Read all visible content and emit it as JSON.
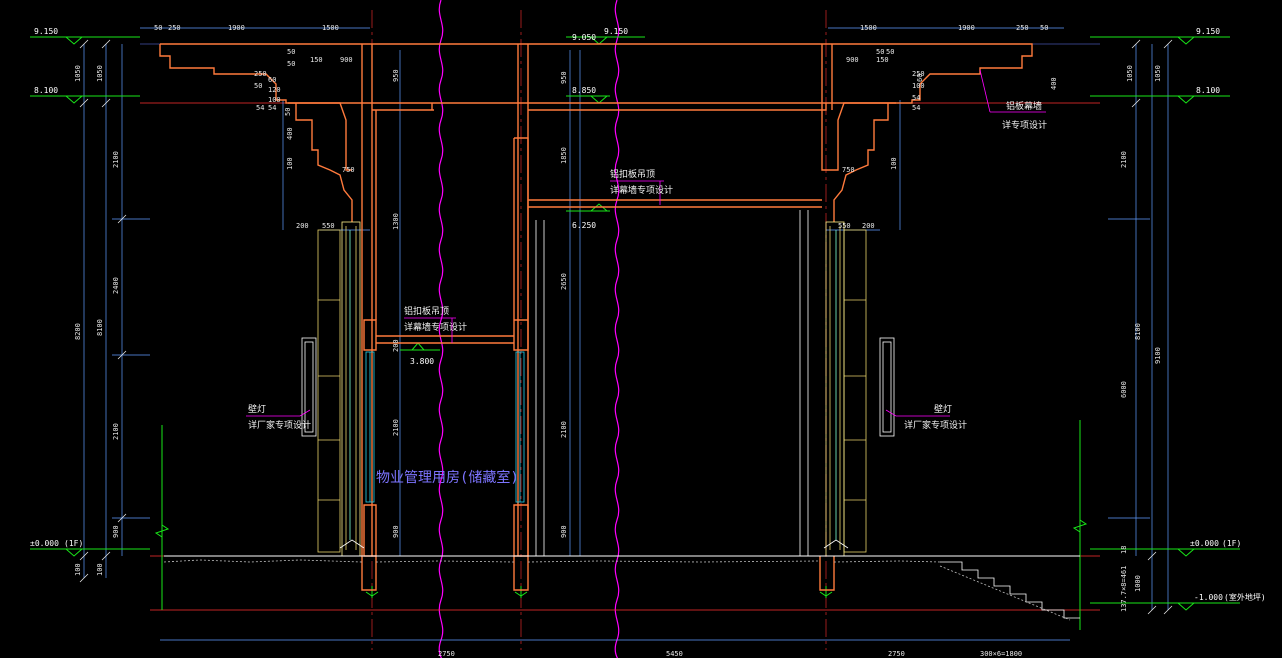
{
  "drawing": {
    "room_label": "物业管理用房(储藏室)",
    "colors": {
      "background": "#000000",
      "wall": "#ff7a3c",
      "dim_line": "#5f9dff",
      "level_mark": "#19e619",
      "break_line": "#ff00ff",
      "glass": "#22d3ee",
      "column": "#e8d26a",
      "note_leader": "#ff00ff",
      "text": "#ffffff",
      "room_text": "#7d74ff"
    },
    "levels": {
      "top_left": "9.150",
      "eave_left": "8.100",
      "ground_left": "±0.000",
      "ground_left_floor": "(1F)",
      "top_mid": "9.050",
      "top_mid2": "9.150",
      "eave_mid": "8.850",
      "mid_ceiling": "6.250",
      "low_ceiling": "3.800",
      "top_right": "9.150",
      "eave_right": "8.100",
      "ground_right": "±0.000",
      "ground_right_floor": "(1F)",
      "outdoor_right": "-1.000",
      "outdoor_right_note": "(室外地坪)"
    },
    "dims": {
      "top_left": [
        "50",
        "250",
        "1900",
        "1500"
      ],
      "top_right": [
        "1500",
        "1900",
        "250",
        "50"
      ],
      "left_outer": [
        "1050",
        "8200",
        "100"
      ],
      "left_inner": [
        "1050",
        "8100",
        "100"
      ],
      "left_segments": [
        "2100",
        "2400",
        "2100",
        "900"
      ],
      "mid_col": [
        "950",
        "1850",
        "2650",
        "2100",
        "900"
      ],
      "mid_col2": [
        "1300",
        "200",
        "2100",
        "900"
      ],
      "right_outer": [
        "1050",
        "8100",
        "1000"
      ],
      "right_inner": [
        "1050",
        "9100"
      ],
      "right_segments": [
        "2100",
        "6000",
        "18"
      ],
      "stair": "137.7×8=461",
      "bottom": [
        "2750",
        "5450",
        "2750",
        "300×6=1800"
      ],
      "cornice_left": [
        "50",
        "50",
        "150",
        "900",
        "250",
        "50",
        "60",
        "120",
        "100",
        "54",
        "54",
        "50"
      ],
      "cornice_right": [
        "900",
        "150",
        "50",
        "50",
        "250",
        "100",
        "54",
        "54",
        "60",
        "400"
      ],
      "pillar_left": [
        "750",
        "200",
        "550"
      ],
      "pillar_right": [
        "750",
        "550",
        "200"
      ],
      "mid_small": [
        "100",
        "400",
        "100"
      ]
    },
    "notes": {
      "left_top": "铝扣板吊顶",
      "left_top_sub": "详幕墙专项设计",
      "mid_top": "铝扣板吊顶",
      "mid_top_sub": "详幕墙专项设计",
      "right_top": "铝板幕墙",
      "right_top_sub": "详专项设计",
      "left_lamp": "壁灯",
      "left_lamp_sub": "详厂家专项设计",
      "right_lamp": "壁灯",
      "right_lamp_sub": "详厂家专项设计"
    }
  }
}
